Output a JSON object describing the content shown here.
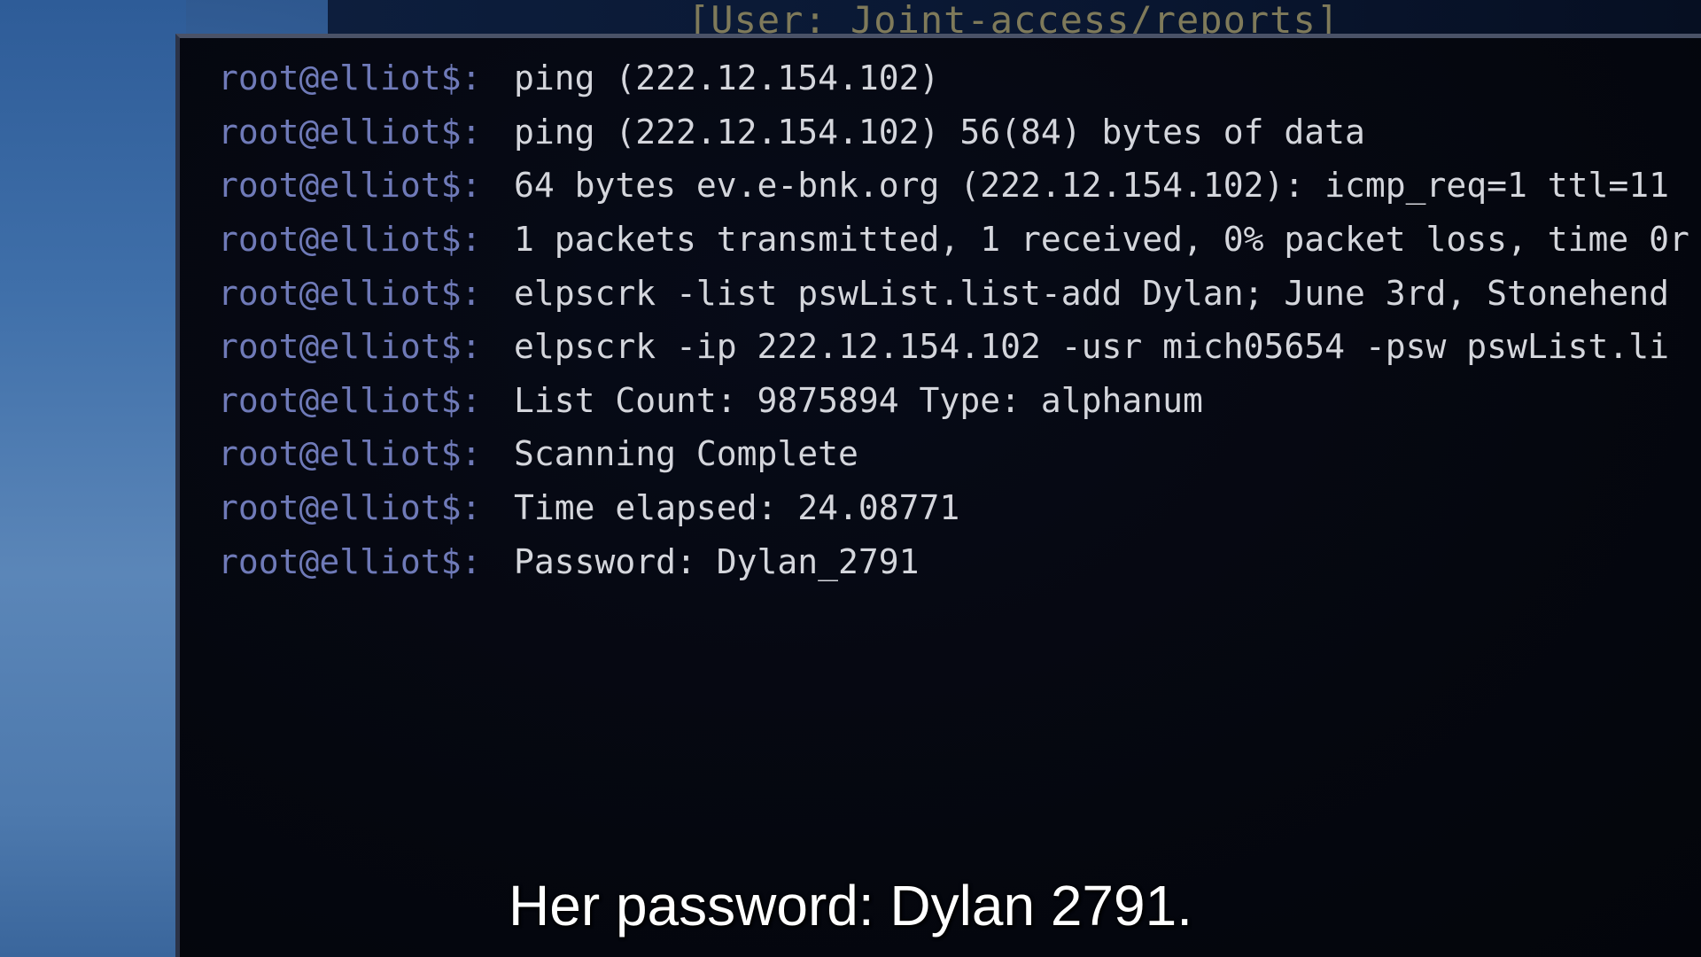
{
  "window": {
    "title": "[User: Joint-access/reports]"
  },
  "terminal": {
    "lines": [
      {
        "prompt": "root@elliot$:",
        "text": "ping (222.12.154.102)"
      },
      {
        "prompt": "root@elliot$:",
        "text": "ping (222.12.154.102) 56(84) bytes of data"
      },
      {
        "prompt": "root@elliot$:",
        "text": "64 bytes ev.e-bnk.org (222.12.154.102): icmp_req=1 ttl=11"
      },
      {
        "prompt": "root@elliot$:",
        "text": "1 packets transmitted, 1 received, 0% packet loss, time 0r"
      },
      {
        "prompt": "root@elliot$:",
        "text": "elpscrk -list pswList.list-add Dylan; June 3rd, Stonehend"
      },
      {
        "prompt": "root@elliot$:",
        "text": "elpscrk  -ip 222.12.154.102 -usr mich05654 -psw pswList.li"
      },
      {
        "prompt": "root@elliot$:",
        "text": "List Count: 9875894 Type: alphanum"
      },
      {
        "prompt": "root@elliot$:",
        "text": "Scanning Complete"
      },
      {
        "prompt": "root@elliot$:",
        "text": "Time elapsed: 24.08771"
      },
      {
        "prompt": "root@elliot$:",
        "text": "Password: Dylan_2791"
      }
    ]
  },
  "subtitle": {
    "text": "Her password: Dylan 2791."
  }
}
